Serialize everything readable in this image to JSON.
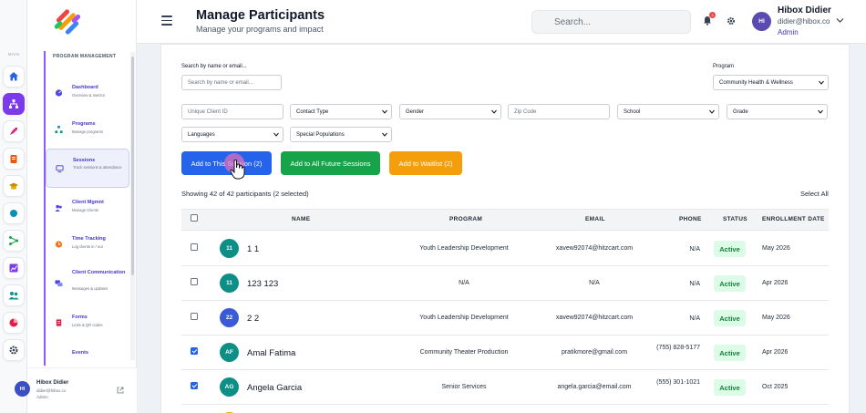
{
  "rail": {
    "section_label": "MAIN",
    "items": [
      {
        "icon": "home-icon",
        "color": "#2563eb"
      },
      {
        "icon": "sitemap-icon",
        "color": "#ffffff",
        "active": true
      },
      {
        "icon": "rocket-icon",
        "color": "#db2777"
      },
      {
        "icon": "clipboard-icon",
        "color": "#ea580c"
      },
      {
        "icon": "graduation-cap-icon",
        "color": "#ca8a04"
      },
      {
        "icon": "circle-icon",
        "color": "#0891b2"
      },
      {
        "icon": "flow-icon",
        "color": "#16a34a"
      },
      {
        "icon": "chart-icon",
        "color": "#7c3aed"
      },
      {
        "icon": "users-icon",
        "color": "#0d9488"
      },
      {
        "icon": "pie-icon",
        "color": "#e11d48"
      },
      {
        "icon": "settings-icon",
        "color": "#334155"
      }
    ]
  },
  "sidebar": {
    "section_title": "PROGRAM MANAGEMENT",
    "items": [
      {
        "label": "Dashboard",
        "sub": "Overview & metrics",
        "icon": "dashboard-icon"
      },
      {
        "label": "Programs",
        "sub": "Manage programs",
        "icon": "programs-icon"
      },
      {
        "label": "Sessions",
        "sub": "Track sessions & attendance",
        "icon": "sessions-icon",
        "active": true
      },
      {
        "label": "Client Mgmnt",
        "sub": "Manage Clients",
        "icon": "clients-icon"
      },
      {
        "label": "Time Tracking",
        "sub": "Log clients in / out",
        "icon": "clock-icon"
      },
      {
        "label": "Client Communication",
        "sub": "Messages & updates",
        "icon": "chat-icon"
      },
      {
        "label": "Forms",
        "sub": "Links & QR codes",
        "icon": "forms-icon"
      },
      {
        "label": "Events",
        "sub": "",
        "icon": ""
      }
    ],
    "user": {
      "initials": "HI",
      "name": "Hibox Didier",
      "email": "didier@hibox.co",
      "role": "Admin"
    }
  },
  "header": {
    "title": "Manage Participants",
    "subtitle": "Manage your programs and impact",
    "search_placeholder": "Search...",
    "notification_count": "3",
    "user": {
      "initials": "HI",
      "name": "Hibox Didier",
      "email": "didier@hibox.co",
      "role": "Admin"
    }
  },
  "filters": {
    "search_label": "Search by name or email...",
    "search_placeholder": "Search by name or email...",
    "program_label": "Program",
    "program_value": "Community Health & Wellness",
    "client_id_placeholder": "Unique Client ID",
    "contact_type": "Contact Type",
    "gender": "Gender",
    "zip_placeholder": "Zip Code",
    "school": "School",
    "grade": "Grade",
    "languages": "Languages",
    "special_populations": "Special Populations"
  },
  "actions": {
    "add_session": "Add to This Session (2)",
    "add_future": "Add to All Future Sessions",
    "add_waitlist": "Add to Waitlist (2)"
  },
  "summary": {
    "showing": "Showing 42 of 42 participants (2 selected)",
    "select_all": "Select All"
  },
  "table": {
    "columns": [
      "NAME",
      "PROGRAM",
      "EMAIL",
      "PHONE",
      "STATUS",
      "ENROLLMENT DATE"
    ],
    "rows": [
      {
        "initials": "11",
        "name": "1 1",
        "program": "Youth Leadership Development",
        "email": "xavew92074@hitzcart.com",
        "phone": "N/A",
        "status": "Active",
        "date": "May 2026",
        "checked": false,
        "color": "teal"
      },
      {
        "initials": "11",
        "name": "123 123",
        "program": "N/A",
        "email": "N/A",
        "phone": "N/A",
        "status": "Active",
        "date": "Apr 2026",
        "checked": false,
        "color": "teal"
      },
      {
        "initials": "22",
        "name": "2 2",
        "program": "Youth Leadership Development",
        "email": "xavew92074@hitzcart.com",
        "phone": "N/A",
        "status": "Active",
        "date": "May 2026",
        "checked": false,
        "color": "blue"
      },
      {
        "initials": "AF",
        "name": "Amal Fatima",
        "program": "Community Theater Production",
        "email": "pratikmore@gmail.com",
        "phone": "(755) 828-5177",
        "status": "Active",
        "date": "Apr 2026",
        "checked": true,
        "color": "teal"
      },
      {
        "initials": "AG",
        "name": "Angela Garcia",
        "program": "Senior Services",
        "email": "angela.garcia@email.com",
        "phone": "(555) 301-1021",
        "status": "Active",
        "date": "Oct 2025",
        "checked": true,
        "color": "teal"
      }
    ]
  }
}
